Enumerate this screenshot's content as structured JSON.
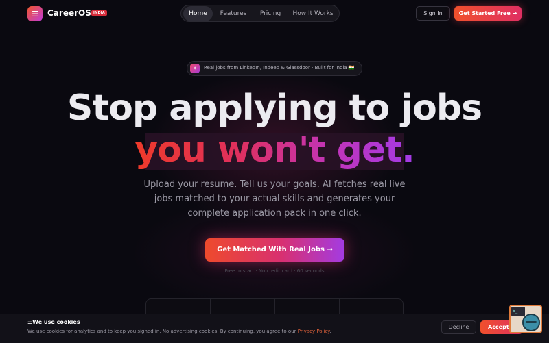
{
  "nav": {
    "brand": "CareerOS",
    "brand_badge": "INDIA",
    "logo_icon": "list-icon",
    "links": [
      {
        "label": "Home",
        "active": true
      },
      {
        "label": "Features",
        "active": false
      },
      {
        "label": "Pricing",
        "active": false
      },
      {
        "label": "How It Works",
        "active": false
      }
    ],
    "signin_label": "Sign In",
    "cta_label": "Get Started Free →"
  },
  "hero": {
    "announcement": "Real jobs from LinkedIn, Indeed & Glassdoor · Built for India 🇮🇳",
    "announcement_icon": "sparkle-icon",
    "headline_line1": "Stop applying to jobs",
    "headline_line2": "you won't get.",
    "subtitle": "Upload your resume. Tell us your goals. AI fetches real live jobs matched to your actual skills and generates your complete application pack in one click.",
    "cta_label": "Get Matched With Real Jobs →",
    "fine_print": "Free to start · No credit card · 60 seconds"
  },
  "cookie": {
    "title": "We use cookies",
    "title_icon": "list-icon",
    "text": "We use cookies for analytics and to keep you signed in. No advertising cookies. By continuing, you agree to our ",
    "link": "Privacy Policy",
    "text_end": ".",
    "decline_label": "Decline",
    "accept_label": "Accept All"
  },
  "colors": {
    "accent_orange": "#f0502c",
    "accent_pink": "#df2f62",
    "accent_purple": "#a33be6",
    "background": "#0a0910"
  }
}
